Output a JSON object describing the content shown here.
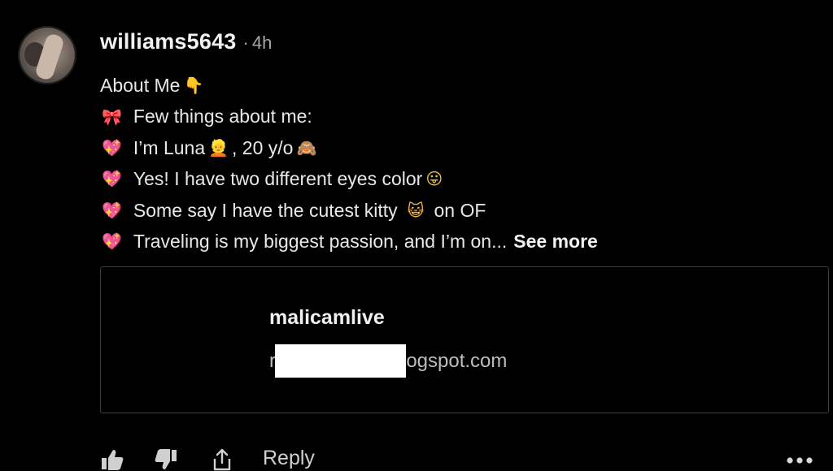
{
  "comment": {
    "username": "williams5643",
    "separator": "·",
    "timestamp": "4h",
    "lines": [
      {
        "text": "About Me",
        "emoji": "hand-pointing-down"
      },
      {
        "text": "Few things about me:",
        "emoji": "ribbon-bow"
      },
      {
        "text_a": "I’m Luna",
        "text_b": ", 20 y/o",
        "emoji": "sparkling-heart"
      },
      {
        "text": "Yes! I have two different eyes color",
        "emoji": "sparkling-heart"
      },
      {
        "text_a": "Some say I have the cutest kitty",
        "text_b": "on OF",
        "emoji": "sparkling-heart"
      },
      {
        "text": "Traveling is my biggest passion, and I’m on...",
        "emoji": "sparkling-heart"
      }
    ],
    "see_more_label": "See more"
  },
  "link_preview": {
    "title": "malicamlive",
    "url_prefix": "r",
    "url_suffix": "logspot.com"
  },
  "actions": {
    "reply_label": "Reply"
  },
  "colors": {
    "background": "#000000",
    "text": "#e8e8e8",
    "muted": "#a8a8a8",
    "card_border": "#3c3c3c",
    "heart_emoji": "#ff4f7d"
  }
}
